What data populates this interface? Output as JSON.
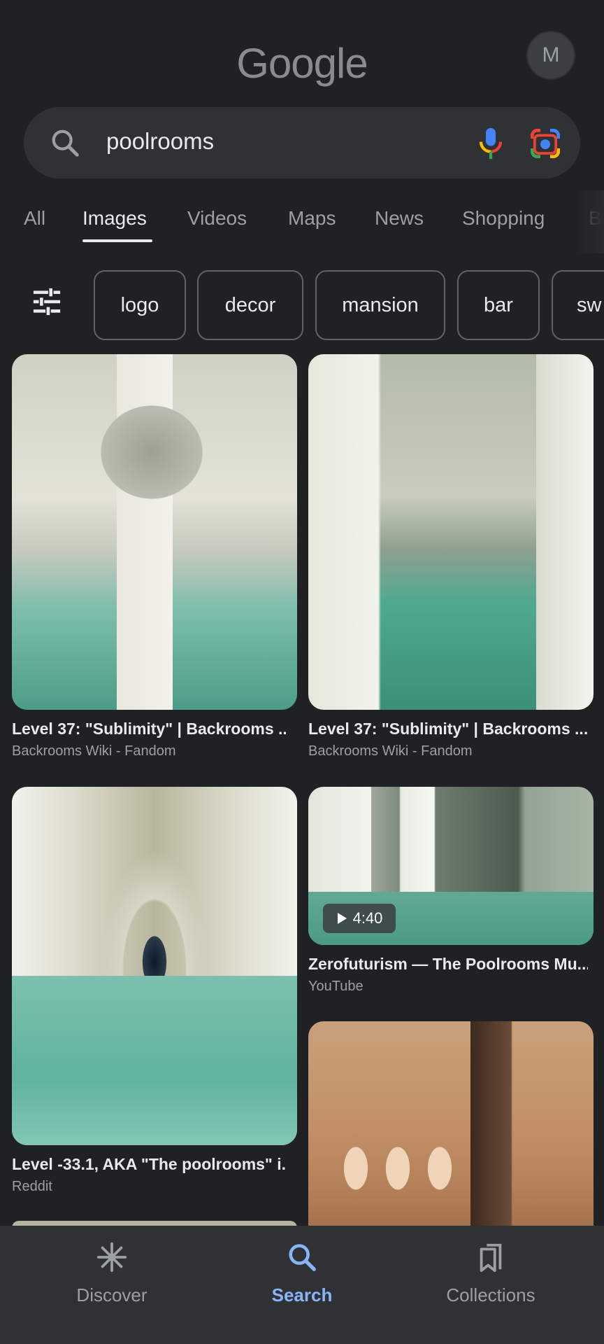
{
  "header": {
    "logo_text": "Google",
    "avatar_initial": "M"
  },
  "search": {
    "query": "poolrooms",
    "icons": [
      "search-icon",
      "mic-icon",
      "lens-icon"
    ]
  },
  "tabs": [
    {
      "label": "All",
      "active": false
    },
    {
      "label": "Images",
      "active": true
    },
    {
      "label": "Videos",
      "active": false
    },
    {
      "label": "Maps",
      "active": false
    },
    {
      "label": "News",
      "active": false
    },
    {
      "label": "Shopping",
      "active": false
    },
    {
      "label": "B",
      "active": false
    }
  ],
  "chips": [
    "logo",
    "decor",
    "mansion",
    "bar",
    "sw"
  ],
  "results": [
    {
      "title": "Level 37: \"Sublimity\" | Backrooms ...",
      "source": "Backrooms Wiki - Fandom"
    },
    {
      "title": "Level 37: \"Sublimity\" | Backrooms ...",
      "source": "Backrooms Wiki - Fandom"
    },
    {
      "title": "Level -33.1, AKA \"The poolrooms\" i...",
      "source": "Reddit"
    },
    {
      "title": "Zerofuturism — The Poolrooms Mu...",
      "source": "YouTube",
      "duration": "4:40"
    }
  ],
  "bottom_nav": [
    {
      "label": "Discover",
      "icon": "asterisk-icon",
      "active": false
    },
    {
      "label": "Search",
      "icon": "search-icon",
      "active": true
    },
    {
      "label": "Collections",
      "icon": "bookmarks-icon",
      "active": false
    }
  ],
  "colors": {
    "background": "#202124",
    "surface": "#303134",
    "accent": "#8ab4f8"
  }
}
